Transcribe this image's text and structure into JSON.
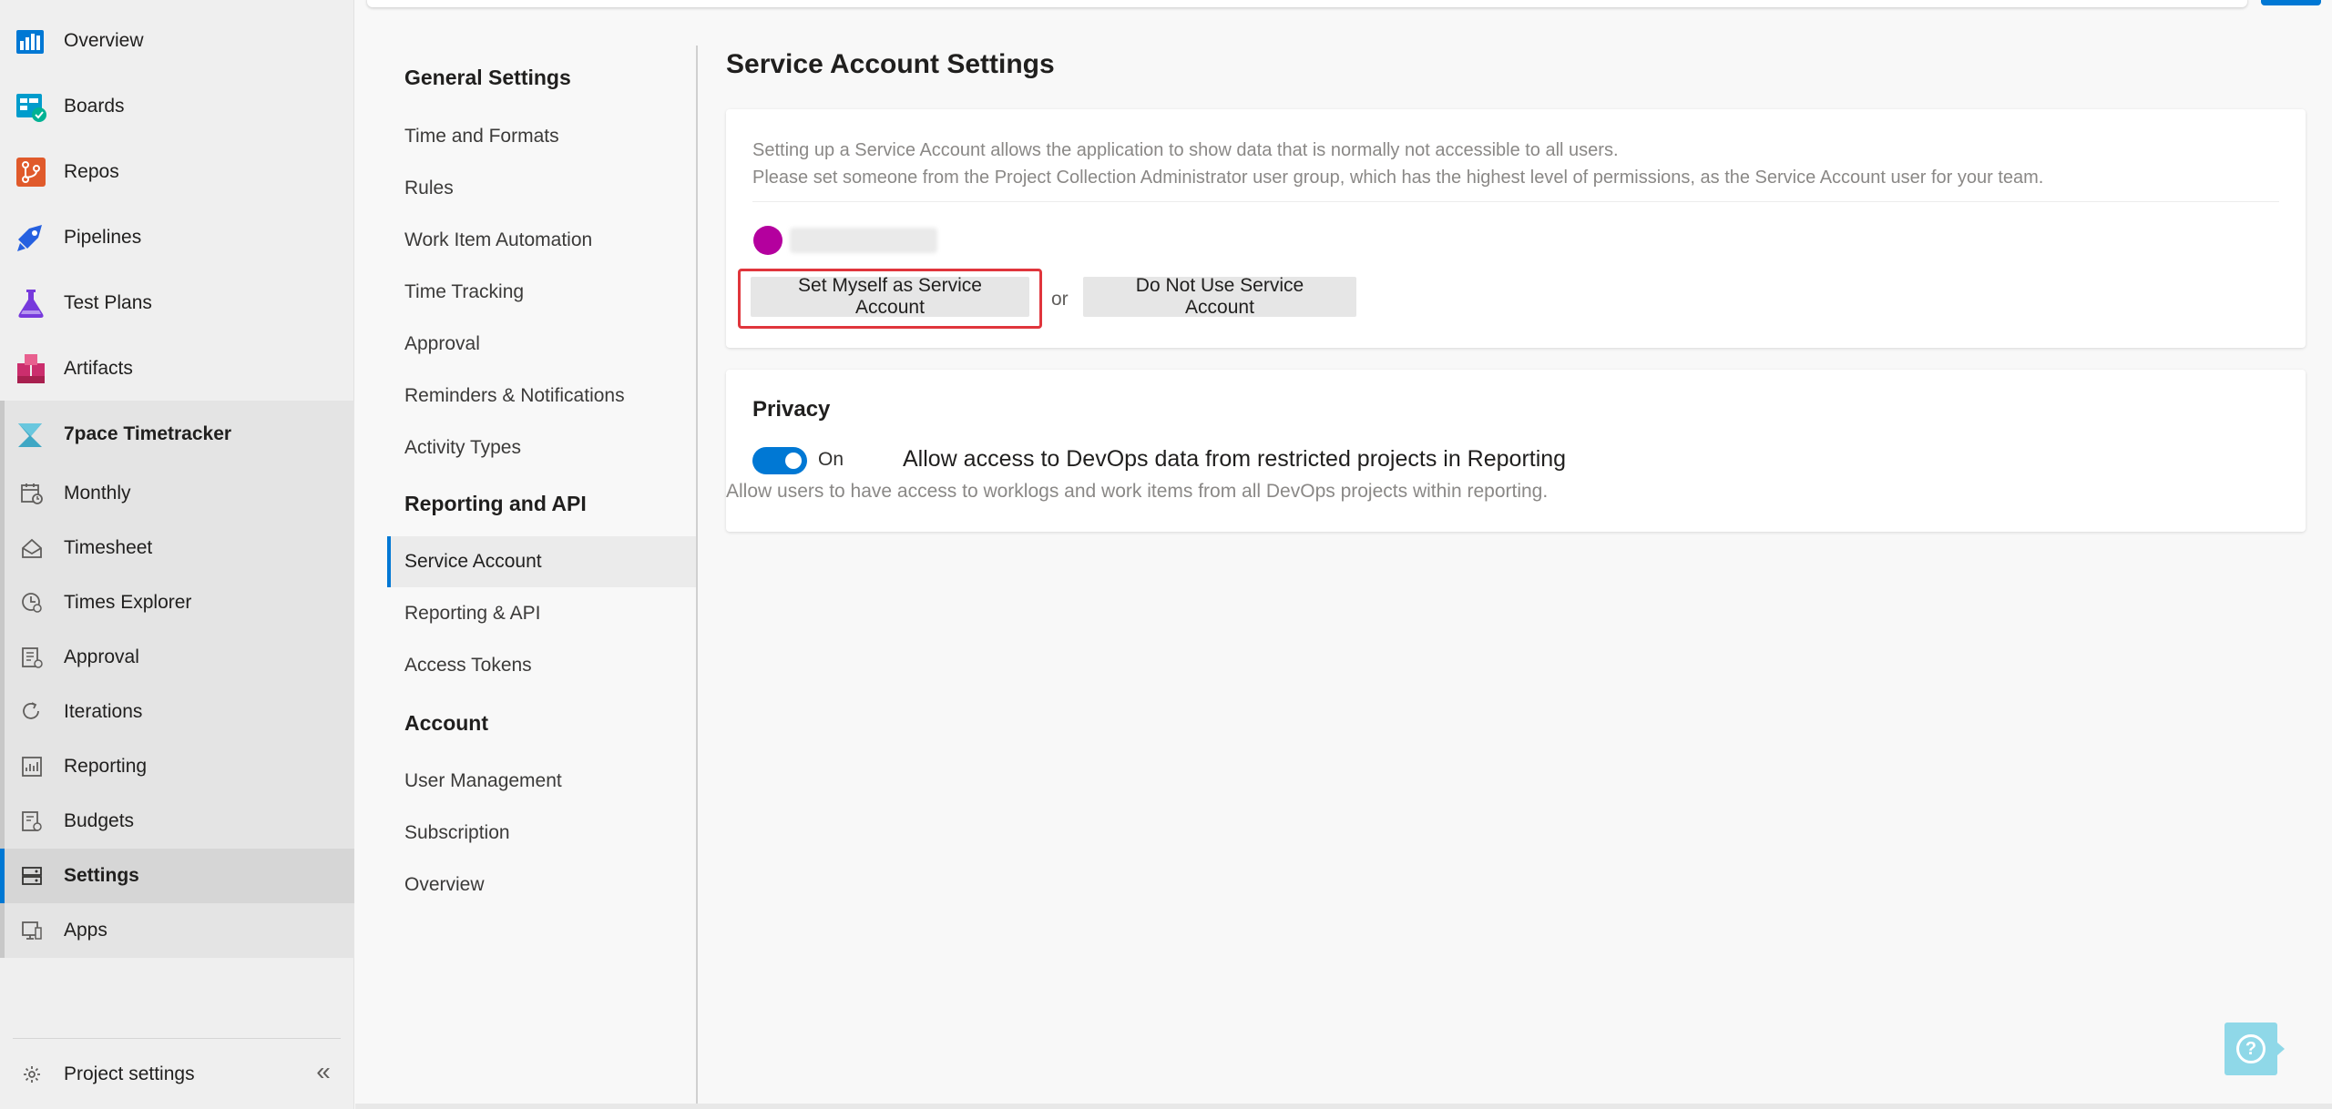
{
  "nav": {
    "items": [
      {
        "label": "Overview",
        "icon": "overview-icon"
      },
      {
        "label": "Boards",
        "icon": "boards-icon"
      },
      {
        "label": "Repos",
        "icon": "repos-icon"
      },
      {
        "label": "Pipelines",
        "icon": "pipelines-icon"
      },
      {
        "label": "Test Plans",
        "icon": "test-plans-icon"
      },
      {
        "label": "Artifacts",
        "icon": "artifacts-icon"
      },
      {
        "label": "7pace Timetracker",
        "icon": "timetracker-icon"
      }
    ],
    "sub_items": [
      {
        "label": "Monthly",
        "icon": "calendar-icon"
      },
      {
        "label": "Timesheet",
        "icon": "timesheet-icon"
      },
      {
        "label": "Times Explorer",
        "icon": "clock-icon"
      },
      {
        "label": "Approval",
        "icon": "approval-icon"
      },
      {
        "label": "Iterations",
        "icon": "iterations-icon"
      },
      {
        "label": "Reporting",
        "icon": "reporting-icon"
      },
      {
        "label": "Budgets",
        "icon": "budgets-icon"
      },
      {
        "label": "Settings",
        "icon": "settings-icon"
      },
      {
        "label": "Apps",
        "icon": "apps-icon"
      }
    ],
    "active_sub_item": "Settings",
    "project_settings": "Project settings",
    "collapse_glyph": "«"
  },
  "settings_nav": {
    "sections": [
      {
        "header": "General Settings",
        "items": [
          "Time and Formats",
          "Rules",
          "Work Item Automation",
          "Time Tracking",
          "Approval",
          "Reminders & Notifications",
          "Activity Types"
        ]
      },
      {
        "header": "Reporting and API",
        "items": [
          "Service Account",
          "Reporting & API",
          "Access Tokens"
        ]
      },
      {
        "header": "Account",
        "items": [
          "User Management",
          "Subscription",
          "Overview"
        ]
      }
    ],
    "active_item": "Service Account"
  },
  "main": {
    "title": "Service Account Settings",
    "service_card": {
      "desc_line1": "Setting up a Service Account allows the application to show data that is normally not accessible to all users.",
      "desc_line2": "Please set someone from the Project Collection Administrator user group, which has the highest level of permissions, as the Service Account user for your team.",
      "set_myself_label": "Set Myself as Service Account",
      "or_label": "or",
      "do_not_use_label": "Do Not Use Service Account",
      "avatar_color": "#b4009e"
    },
    "privacy_card": {
      "title": "Privacy",
      "toggle_state": "On",
      "heading": "Allow access to DevOps data from restricted projects in Reporting",
      "subtext": "Allow users to have access to worklogs and work items from all DevOps projects within reporting."
    }
  },
  "help": {
    "glyph": "?"
  },
  "colors": {
    "accent": "#0078d4",
    "highlight": "#e0353c",
    "help_bg": "#8fd8e8"
  }
}
